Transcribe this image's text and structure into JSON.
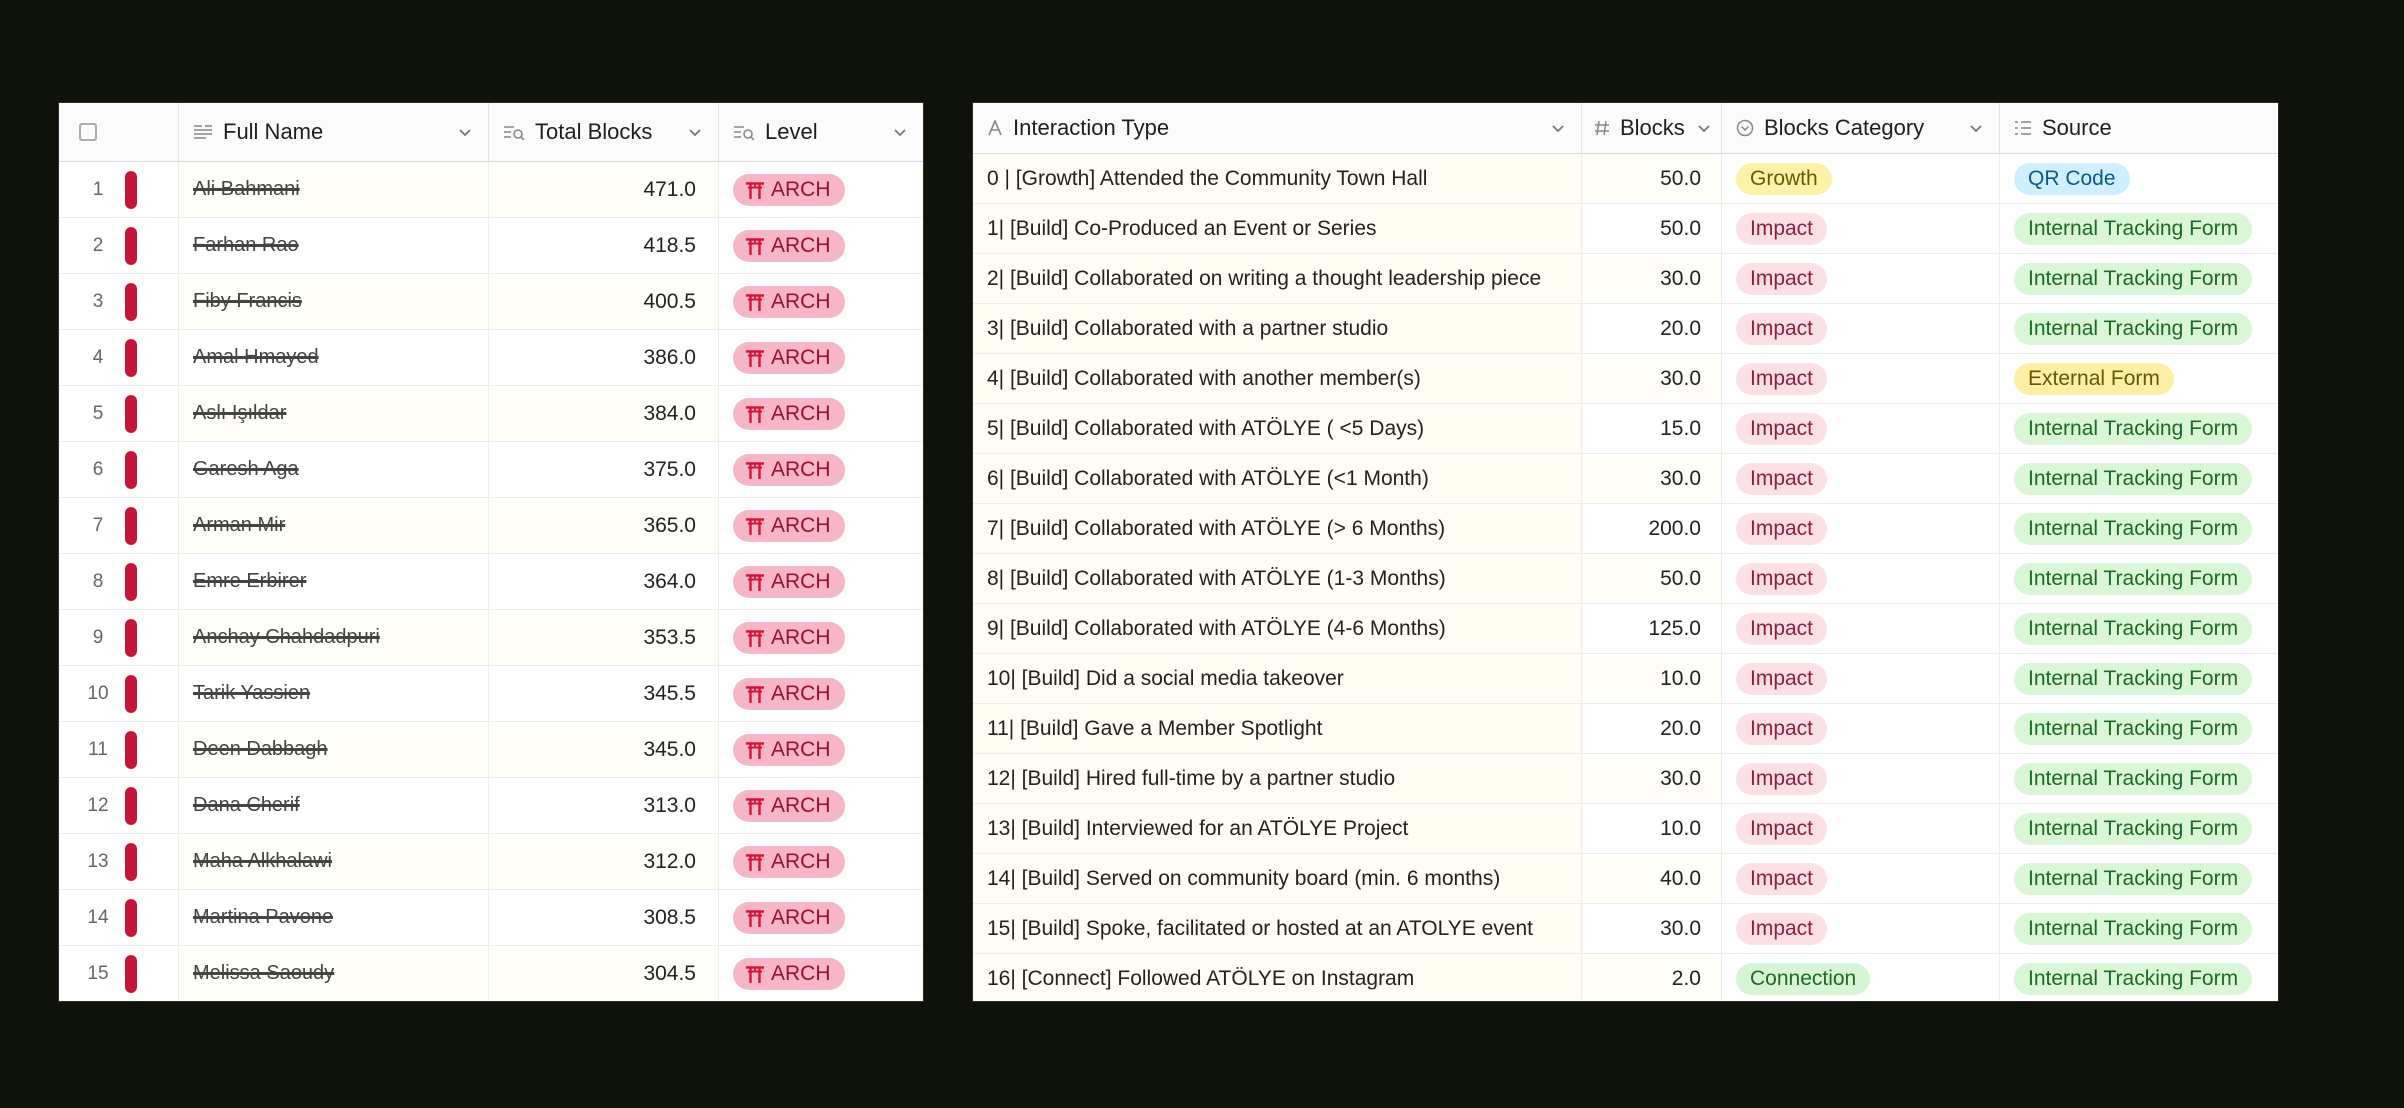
{
  "left_table": {
    "headers": {
      "full_name": "Full Name",
      "total_blocks": "Total Blocks",
      "level": "Level"
    },
    "rows": [
      {
        "num": "1",
        "name": "Ali Bahmani",
        "total": "471.0",
        "level": "ARCH"
      },
      {
        "num": "2",
        "name": "Farhan Rao",
        "total": "418.5",
        "level": "ARCH"
      },
      {
        "num": "3",
        "name": "Fiby Francis",
        "total": "400.5",
        "level": "ARCH"
      },
      {
        "num": "4",
        "name": "Amal Hmayed",
        "total": "386.0",
        "level": "ARCH"
      },
      {
        "num": "5",
        "name": "Aslı Işıldar",
        "total": "384.0",
        "level": "ARCH"
      },
      {
        "num": "6",
        "name": "Garesh Aga",
        "total": "375.0",
        "level": "ARCH"
      },
      {
        "num": "7",
        "name": "Arman Mir",
        "total": "365.0",
        "level": "ARCH"
      },
      {
        "num": "8",
        "name": "Emre Erbirer",
        "total": "364.0",
        "level": "ARCH"
      },
      {
        "num": "9",
        "name": "Anchay Chahdadpuri",
        "total": "353.5",
        "level": "ARCH"
      },
      {
        "num": "10",
        "name": "Tarik Yassien",
        "total": "345.5",
        "level": "ARCH"
      },
      {
        "num": "11",
        "name": "Deen Dabbagh",
        "total": "345.0",
        "level": "ARCH"
      },
      {
        "num": "12",
        "name": "Dana Cherif",
        "total": "313.0",
        "level": "ARCH"
      },
      {
        "num": "13",
        "name": "Maha Alkhalawi",
        "total": "312.0",
        "level": "ARCH"
      },
      {
        "num": "14",
        "name": "Martina Pavone",
        "total": "308.5",
        "level": "ARCH"
      },
      {
        "num": "15",
        "name": "Melissa Saoudy",
        "total": "304.5",
        "level": "ARCH"
      }
    ]
  },
  "right_table": {
    "headers": {
      "interaction_type": "Interaction Type",
      "blocks": "Blocks",
      "blocks_category": "Blocks Category",
      "source": "Source"
    },
    "rows": [
      {
        "type": "0 | [Growth] Attended the Community Town Hall",
        "blocks": "50.0",
        "category": "Growth",
        "source": "QR Code"
      },
      {
        "type": "1| [Build] Co-Produced an Event or Series",
        "blocks": "50.0",
        "category": "Impact",
        "source": "Internal Tracking Form"
      },
      {
        "type": "2| [Build] Collaborated on writing a thought leadership piece",
        "blocks": "30.0",
        "category": "Impact",
        "source": "Internal Tracking Form"
      },
      {
        "type": "3| [Build] Collaborated with a partner studio",
        "blocks": "20.0",
        "category": "Impact",
        "source": "Internal Tracking Form"
      },
      {
        "type": "4| [Build] Collaborated with another member(s)",
        "blocks": "30.0",
        "category": "Impact",
        "source": "External Form"
      },
      {
        "type": "5| [Build] Collaborated with ATÖLYE ( <5 Days)",
        "blocks": "15.0",
        "category": "Impact",
        "source": "Internal Tracking Form"
      },
      {
        "type": "6| [Build] Collaborated with ATÖLYE (<1 Month)",
        "blocks": "30.0",
        "category": "Impact",
        "source": "Internal Tracking Form"
      },
      {
        "type": "7| [Build] Collaborated with ATÖLYE (> 6 Months)",
        "blocks": "200.0",
        "category": "Impact",
        "source": "Internal Tracking Form"
      },
      {
        "type": "8| [Build] Collaborated with ATÖLYE (1-3 Months)",
        "blocks": "50.0",
        "category": "Impact",
        "source": "Internal Tracking Form"
      },
      {
        "type": "9| [Build] Collaborated with ATÖLYE (4-6 Months)",
        "blocks": "125.0",
        "category": "Impact",
        "source": "Internal Tracking Form"
      },
      {
        "type": "10| [Build] Did a social media takeover",
        "blocks": "10.0",
        "category": "Impact",
        "source": "Internal Tracking Form"
      },
      {
        "type": "11| [Build] Gave a Member Spotlight",
        "blocks": "20.0",
        "category": "Impact",
        "source": "Internal Tracking Form"
      },
      {
        "type": "12| [Build] Hired full-time by a partner studio",
        "blocks": "30.0",
        "category": "Impact",
        "source": "Internal Tracking Form"
      },
      {
        "type": "13| [Build] Interviewed for an ATÖLYE Project",
        "blocks": "10.0",
        "category": "Impact",
        "source": "Internal Tracking Form"
      },
      {
        "type": "14| [Build] Served on community board (min. 6 months)",
        "blocks": "40.0",
        "category": "Impact",
        "source": "Internal Tracking Form"
      },
      {
        "type": "15| [Build] Spoke, facilitated or hosted at an ATOLYE event",
        "blocks": "30.0",
        "category": "Impact",
        "source": "Internal Tracking Form"
      },
      {
        "type": "16| [Connect] Followed ATÖLYE on Instagram",
        "blocks": "2.0",
        "category": "Connection",
        "source": "Internal Tracking Form"
      }
    ]
  },
  "colors": {
    "record_bar": "#c4163a",
    "arch_pill_bg": "#f7b6c8",
    "growth_pill_bg": "#fdf2a8",
    "impact_pill_bg": "#fde0e6",
    "connection_pill_bg": "#d6f5d4",
    "qr_pill_bg": "#cfeeff",
    "internal_pill_bg": "#d9f7d6",
    "external_pill_bg": "#fdf0a6"
  },
  "icons": {
    "full_name": "long-text-icon",
    "total_blocks": "rollup-icon",
    "level": "rollup-icon",
    "interaction_type": "text-icon",
    "blocks": "number-icon",
    "blocks_category": "single-select-icon",
    "source": "multiselect-icon",
    "level_pill": "torii-gate-icon"
  }
}
